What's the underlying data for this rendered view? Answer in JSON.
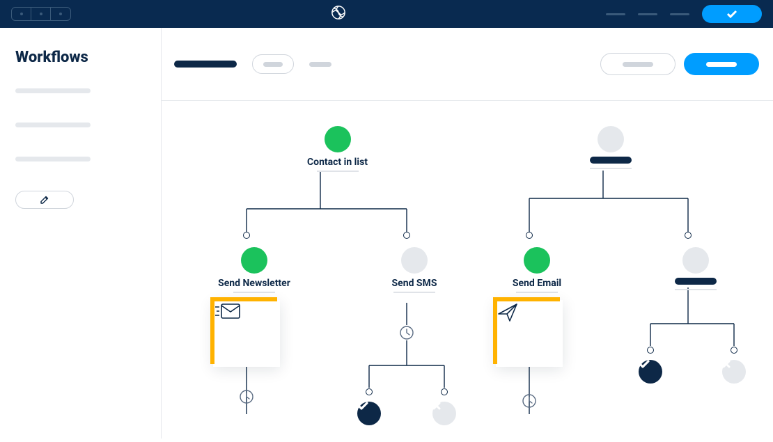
{
  "sidebar": {
    "title": "Workflows"
  },
  "nodes": {
    "contact_in_list": "Contact in list",
    "send_newsletter": "Send Newsletter",
    "send_sms": "Send SMS",
    "send_email": "Send Email"
  },
  "colors": {
    "accent": "#009dff",
    "ok": "#1bc25c",
    "highlight": "#ffb200"
  }
}
